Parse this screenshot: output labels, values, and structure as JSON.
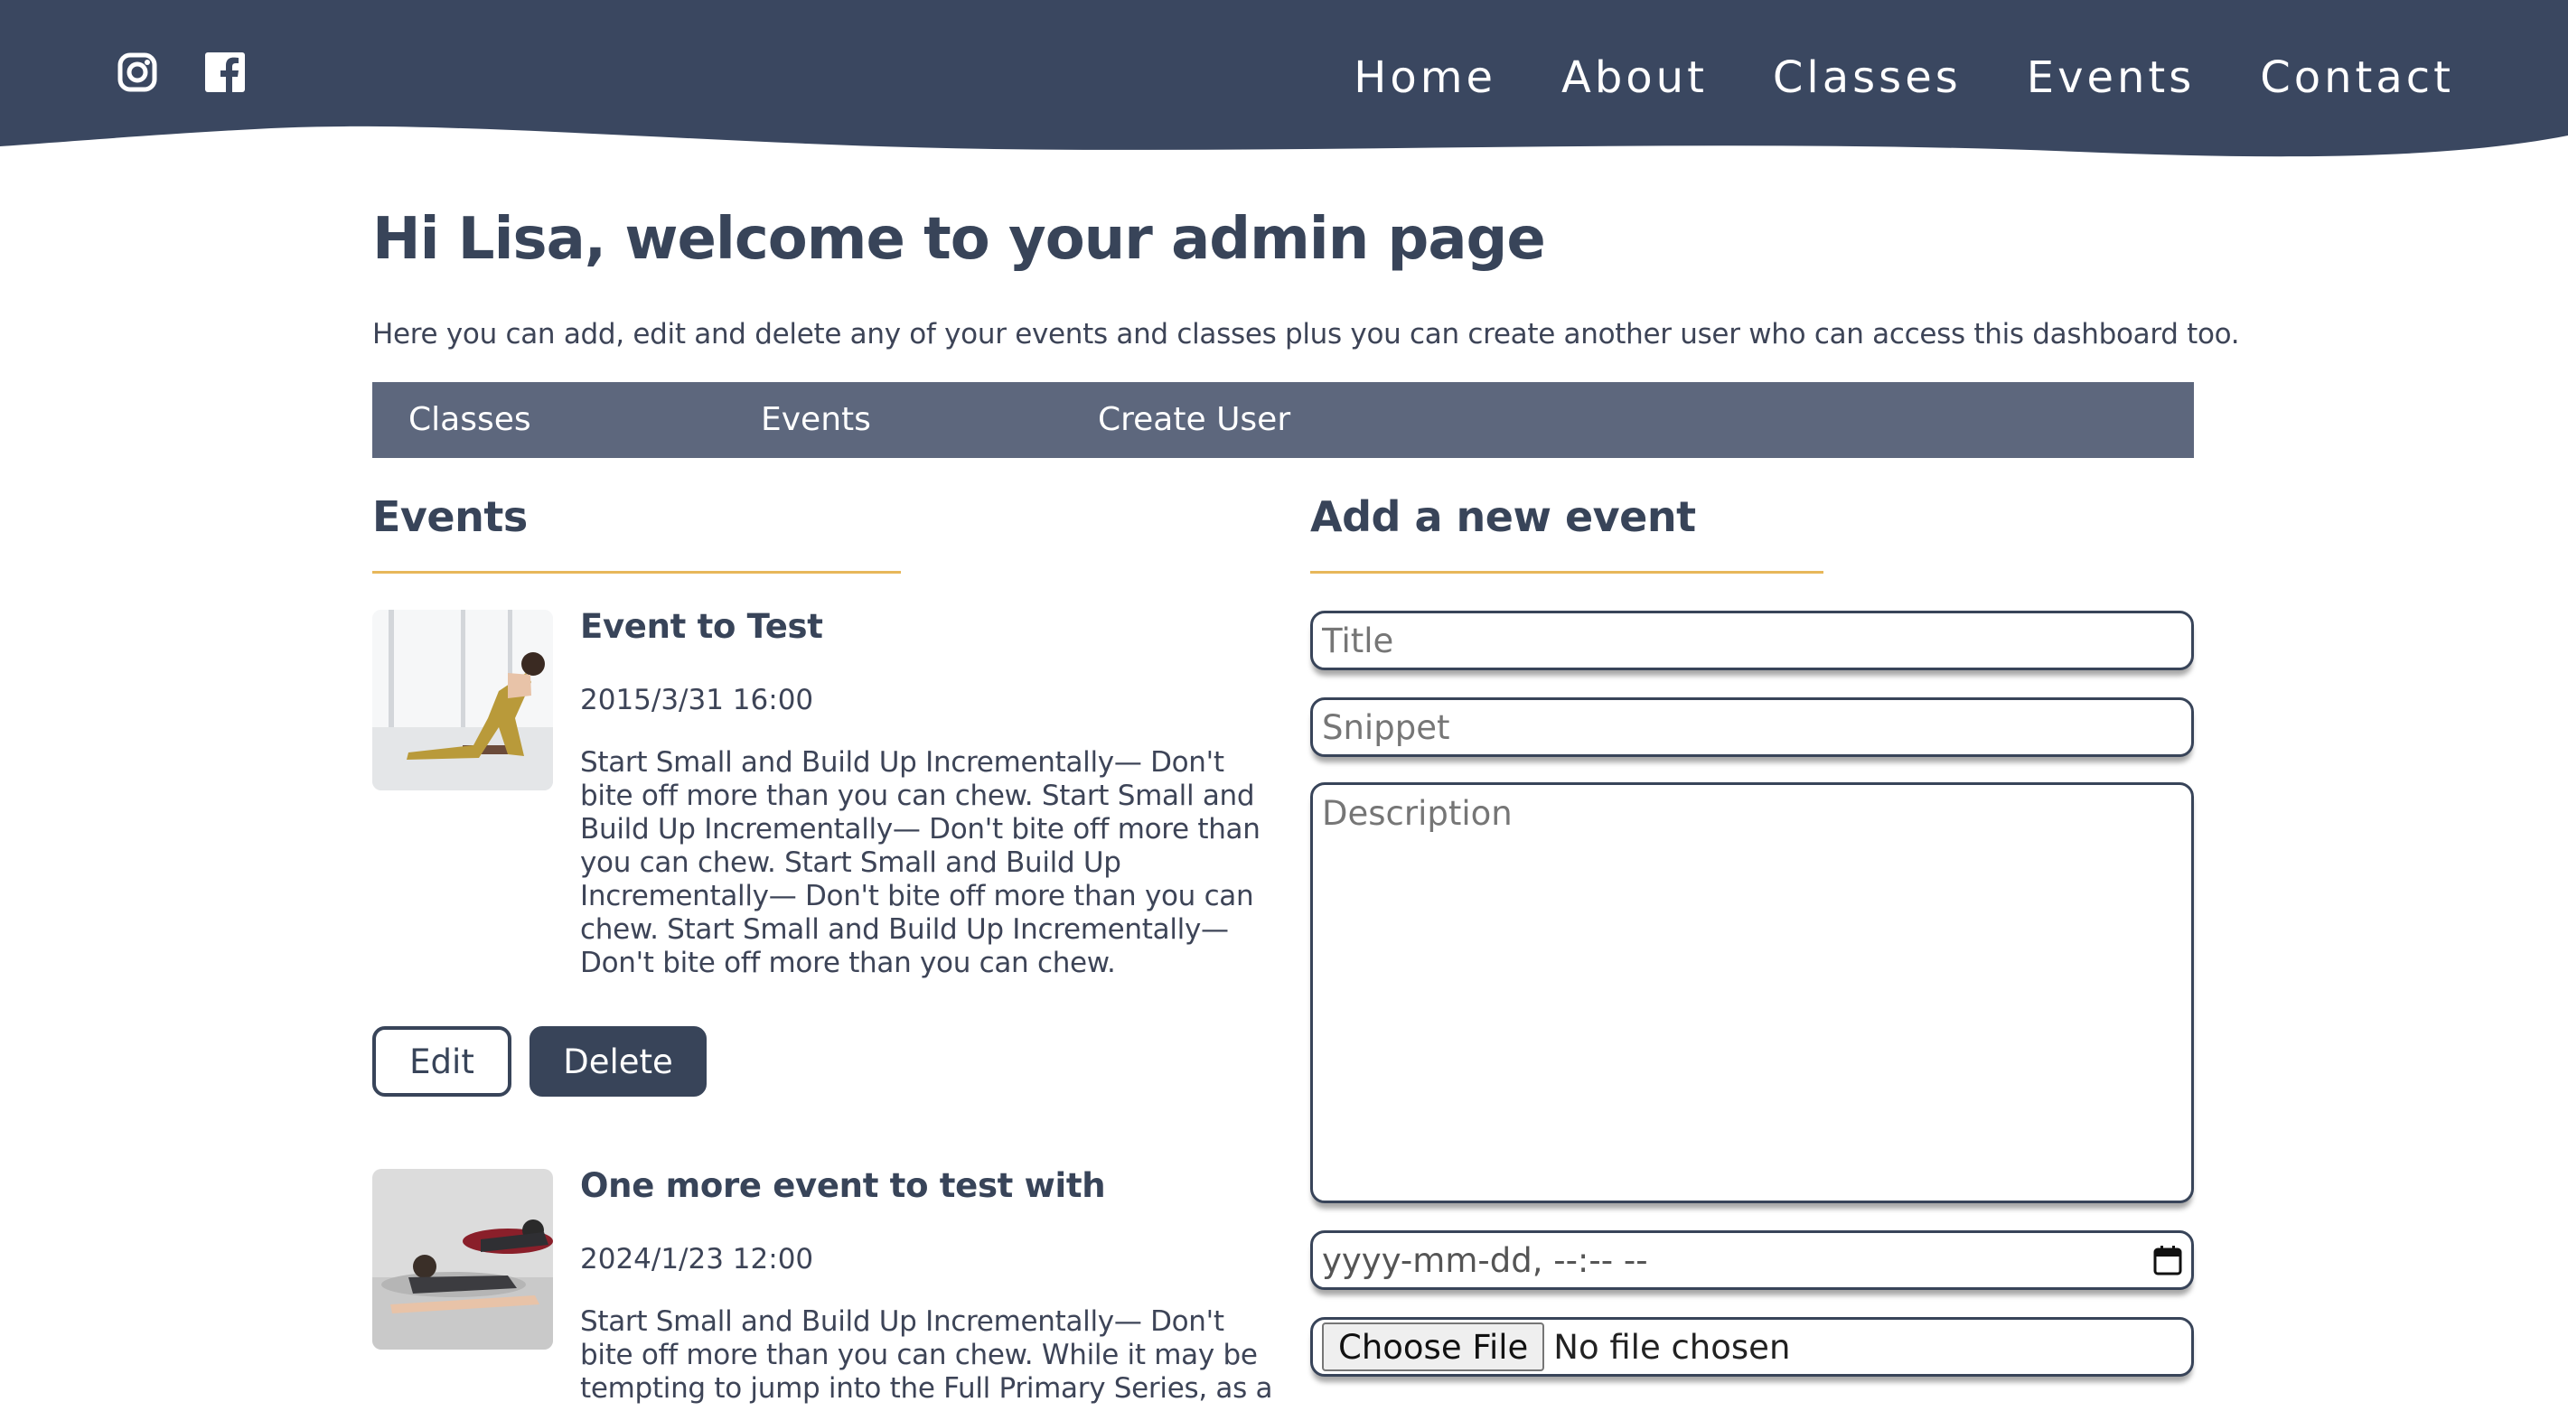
{
  "colors": {
    "header_bg": "#3a4760",
    "accent": "#e7b75a",
    "tab_bar_bg": "#5d677d",
    "primary": "#384459"
  },
  "header": {
    "social": [
      {
        "icon": "instagram-icon"
      },
      {
        "icon": "facebook-icon"
      }
    ],
    "nav": [
      "Home",
      "About",
      "Classes",
      "Events",
      "Contact"
    ]
  },
  "page": {
    "title": "Hi Lisa, welcome to your admin page",
    "intro": "Here you can add, edit and delete any of your events and classes plus you can create another user who can access this dashboard too."
  },
  "tabs": [
    "Classes",
    "Events",
    "Create User"
  ],
  "events_section": {
    "heading": "Events",
    "events": [
      {
        "title": "Event to Test",
        "date": "2015/3/31 16:00",
        "description": "Start Small and Build Up Incrementally— Don't bite off more than you can chew. Start Small and Build Up Incrementally— Don't bite off more than you can chew. Start Small and Build Up Incrementally— Don't bite off more than you can chew. Start Small and Build Up Incrementally— Don't bite off more than you can chew.",
        "edit_label": "Edit",
        "delete_label": "Delete"
      },
      {
        "title": "One more event to test with",
        "date": "2024/1/23 12:00",
        "description": "Start Small and Build Up Incrementally— Don't bite off more than you can chew. While it may be tempting to jump into the Full Primary Series, as a"
      }
    ]
  },
  "form": {
    "heading": "Add a new event",
    "title_placeholder": "Title",
    "snippet_placeholder": "Snippet",
    "description_placeholder": "Description",
    "date_placeholder": "yyyy-mm-dd, --:-- --",
    "file_button": "Choose File",
    "file_status": "No file chosen"
  }
}
